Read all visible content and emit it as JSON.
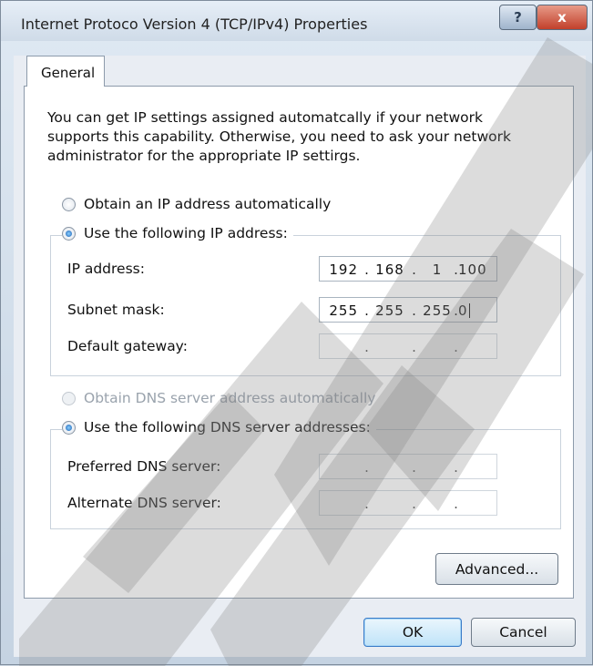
{
  "window": {
    "title": "Internet Protoco Version 4 (TCP/IPv4) Properties",
    "help_label": "?",
    "close_label": "x"
  },
  "tabs": [
    {
      "label": "General",
      "selected": true
    }
  ],
  "intro_text": "You can get IP settings assigned automatcally if your network supports this capability. Otherwise, you need to ask your network administrator for the appropriate IP settirgs.",
  "ip_section": {
    "auto_label": "Obtain an IP address automatically",
    "auto_selected": false,
    "manual_label": "Use the following IP address:",
    "manual_selected": true,
    "fields": [
      {
        "label": "IP address:",
        "octets": [
          "192",
          "168",
          "1",
          "100"
        ]
      },
      {
        "label": "Subnet mask:",
        "octets": [
          "255",
          "255",
          "255",
          "0"
        ]
      },
      {
        "label": "Default gateway:",
        "octets": [
          "",
          "",
          "",
          ""
        ]
      }
    ]
  },
  "dns_section": {
    "auto_label": "Obtain DNS server address automatically",
    "auto_selected": false,
    "auto_disabled": true,
    "manual_label": "Use the following DNS server addresses:",
    "manual_selected": true,
    "fields": [
      {
        "label": "Preferred DNS server:",
        "octets": [
          "",
          "",
          "",
          ""
        ]
      },
      {
        "label": "Alternate DNS server:",
        "octets": [
          "",
          "",
          "",
          ""
        ]
      }
    ]
  },
  "buttons": {
    "advanced": "Advanced...",
    "ok": "OK",
    "cancel": "Cancel"
  },
  "colors": {
    "watermark": "#808080",
    "selected_radio": "#1b5fb3",
    "ok_button_border": "#3a7bc8"
  }
}
